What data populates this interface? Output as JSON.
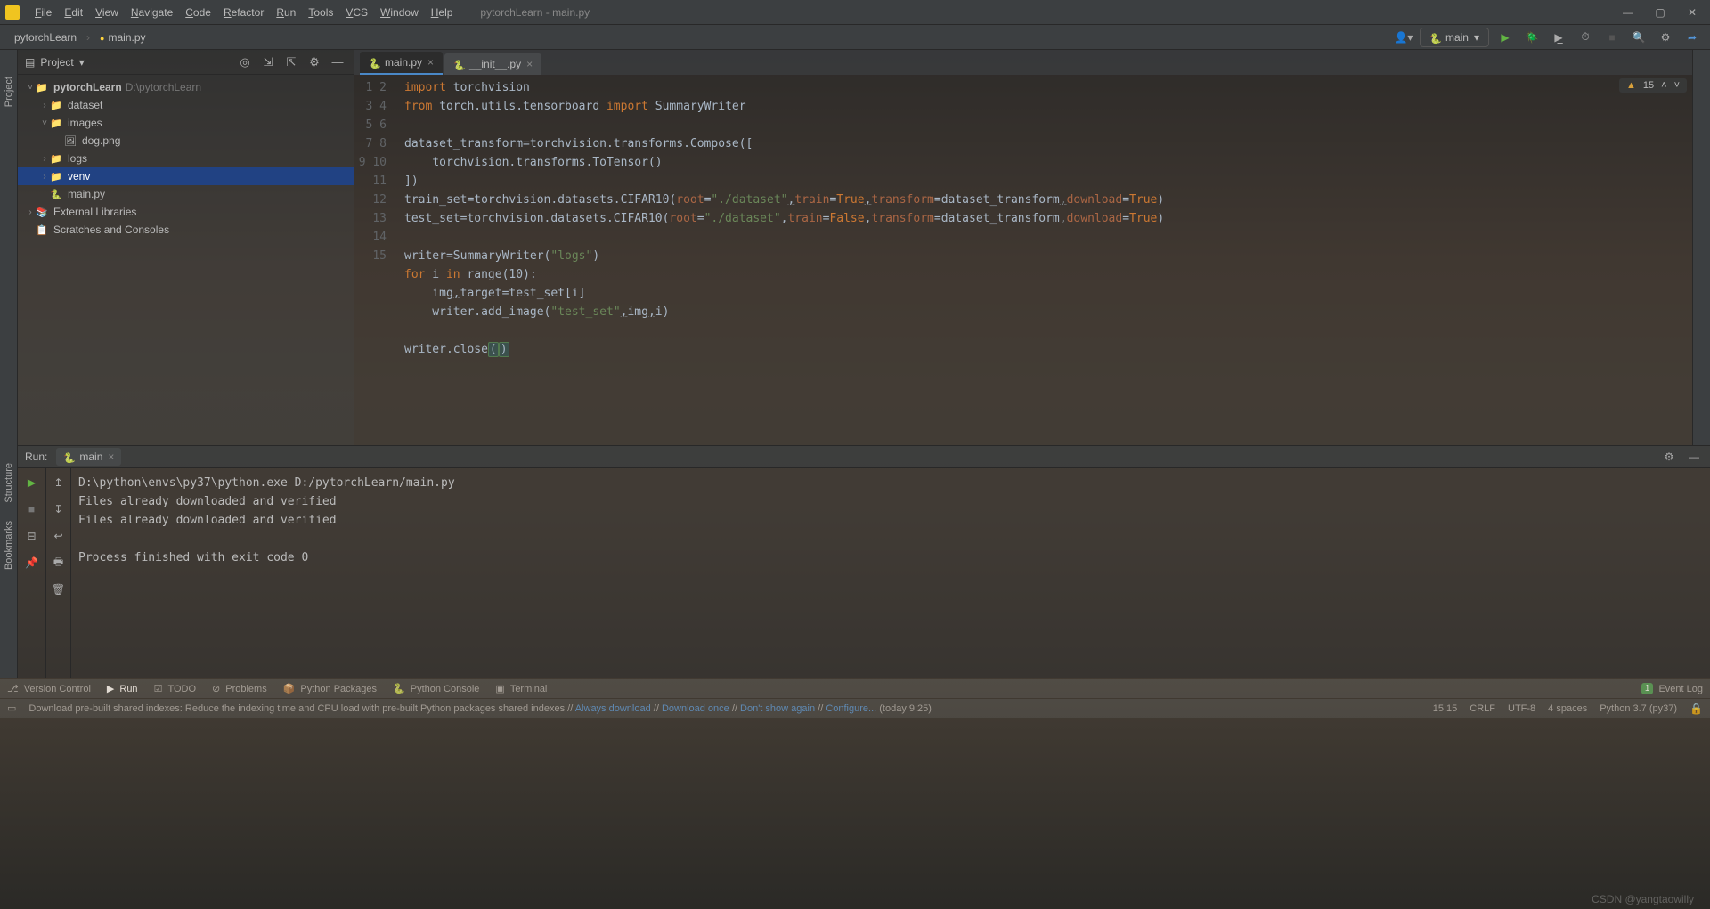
{
  "titlebar": {
    "menus": [
      "File",
      "Edit",
      "View",
      "Navigate",
      "Code",
      "Refactor",
      "Run",
      "Tools",
      "VCS",
      "Window",
      "Help"
    ],
    "title": "pytorchLearn - main.py"
  },
  "breadcrumb": {
    "root": "pytorchLearn",
    "file": "main.py"
  },
  "run_config": {
    "label": "main"
  },
  "project_panel": {
    "title": "Project",
    "root": {
      "name": "pytorchLearn",
      "path": "D:\\pytorchLearn"
    },
    "items": [
      {
        "name": "dataset",
        "type": "folder",
        "depth": 1,
        "expander": "›"
      },
      {
        "name": "images",
        "type": "folder",
        "depth": 1,
        "expander": "˅"
      },
      {
        "name": "dog.png",
        "type": "image",
        "depth": 2
      },
      {
        "name": "logs",
        "type": "folder",
        "depth": 1,
        "expander": "›"
      },
      {
        "name": "venv",
        "type": "venv",
        "depth": 1,
        "expander": "›",
        "selected": true
      },
      {
        "name": "main.py",
        "type": "python",
        "depth": 1
      }
    ],
    "external": "External Libraries",
    "scratches": "Scratches and Consoles"
  },
  "editor": {
    "tabs": [
      {
        "name": "main.py",
        "active": true
      },
      {
        "name": "__init__.py",
        "active": false
      }
    ],
    "warnings": "15",
    "lines": [
      {
        "n": 1,
        "segs": [
          {
            "t": "import",
            "c": "kw"
          },
          {
            "t": " torchvision"
          }
        ]
      },
      {
        "n": 2,
        "segs": [
          {
            "t": "from",
            "c": "kw"
          },
          {
            "t": " torch.utils.tensorboard "
          },
          {
            "t": "import",
            "c": "kw"
          },
          {
            "t": " SummaryWriter"
          }
        ]
      },
      {
        "n": 3,
        "segs": [
          {
            "t": ""
          }
        ]
      },
      {
        "n": 4,
        "segs": [
          {
            "t": "dataset_transform=torchvision.transforms.Compose(["
          }
        ]
      },
      {
        "n": 5,
        "segs": [
          {
            "t": "    torchvision.transforms.ToTensor()"
          }
        ]
      },
      {
        "n": 6,
        "segs": [
          {
            "t": "])"
          }
        ]
      },
      {
        "n": 7,
        "segs": [
          {
            "t": "train_set=torchvision.datasets.CIFAR10("
          },
          {
            "t": "root",
            "c": "arg"
          },
          {
            "t": "="
          },
          {
            "t": "\"./dataset\"",
            "c": "str"
          },
          {
            "t": ",",
            "c": "comma-u"
          },
          {
            "t": "train",
            "c": "arg"
          },
          {
            "t": "="
          },
          {
            "t": "True",
            "c": "bool"
          },
          {
            "t": ",",
            "c": "comma-u"
          },
          {
            "t": "transform",
            "c": "arg"
          },
          {
            "t": "=dataset_transform"
          },
          {
            "t": ",",
            "c": "comma-u"
          },
          {
            "t": "download",
            "c": "arg"
          },
          {
            "t": "="
          },
          {
            "t": "True",
            "c": "bool"
          },
          {
            "t": ")"
          }
        ]
      },
      {
        "n": 8,
        "segs": [
          {
            "t": "test_set=torchvision.datasets.CIFAR10("
          },
          {
            "t": "root",
            "c": "arg"
          },
          {
            "t": "="
          },
          {
            "t": "\"./dataset\"",
            "c": "str"
          },
          {
            "t": ",",
            "c": "comma-u"
          },
          {
            "t": "train",
            "c": "arg"
          },
          {
            "t": "="
          },
          {
            "t": "False",
            "c": "bool"
          },
          {
            "t": ",",
            "c": "comma-u"
          },
          {
            "t": "transform",
            "c": "arg"
          },
          {
            "t": "=dataset_transform"
          },
          {
            "t": ",",
            "c": "comma-u"
          },
          {
            "t": "download",
            "c": "arg"
          },
          {
            "t": "="
          },
          {
            "t": "True",
            "c": "bool"
          },
          {
            "t": ")"
          }
        ]
      },
      {
        "n": 9,
        "segs": [
          {
            "t": ""
          }
        ]
      },
      {
        "n": 10,
        "segs": [
          {
            "t": "writer=SummaryWriter("
          },
          {
            "t": "\"logs\"",
            "c": "str"
          },
          {
            "t": ")"
          }
        ]
      },
      {
        "n": 11,
        "segs": [
          {
            "t": "for",
            "c": "kw"
          },
          {
            "t": " i "
          },
          {
            "t": "in",
            "c": "kw"
          },
          {
            "t": " range(10):"
          }
        ]
      },
      {
        "n": 12,
        "segs": [
          {
            "t": "    img"
          },
          {
            "t": ",",
            "c": "comma-u"
          },
          {
            "t": "target=test_set[i]"
          }
        ]
      },
      {
        "n": 13,
        "segs": [
          {
            "t": "    writer.add_image("
          },
          {
            "t": "\"test_set\"",
            "c": "str"
          },
          {
            "t": ",",
            "c": "comma-u"
          },
          {
            "t": "img"
          },
          {
            "t": ",",
            "c": "comma-u"
          },
          {
            "t": "i)"
          }
        ]
      },
      {
        "n": 14,
        "segs": [
          {
            "t": ""
          }
        ]
      },
      {
        "n": 15,
        "segs": [
          {
            "t": "writer.close"
          },
          {
            "t": "(",
            "c": "paren-hl"
          },
          {
            "t": ")",
            "c": "paren-hl"
          }
        ]
      }
    ]
  },
  "run_panel": {
    "label": "Run:",
    "tab": "main",
    "lines": [
      "D:\\python\\envs\\py37\\python.exe D:/pytorchLearn/main.py",
      "Files already downloaded and verified",
      "Files already downloaded and verified",
      "",
      "Process finished with exit code 0"
    ]
  },
  "left_tools": {
    "project": "Project",
    "structure": "Structure",
    "bookmarks": "Bookmarks"
  },
  "bottom_tools": {
    "items": [
      {
        "name": "Version Control",
        "icon": "⎇"
      },
      {
        "name": "Run",
        "icon": "▶",
        "active": true
      },
      {
        "name": "TODO",
        "icon": "☑"
      },
      {
        "name": "Problems",
        "icon": "⊘"
      },
      {
        "name": "Python Packages",
        "icon": "📦"
      },
      {
        "name": "Python Console",
        "icon": "🐍"
      },
      {
        "name": "Terminal",
        "icon": "▣"
      }
    ],
    "event_log": "Event Log",
    "event_badge": "1"
  },
  "statusbar": {
    "message_prefix": "Download pre-built shared indexes: Reduce the indexing time and CPU load with pre-built Python packages shared indexes //",
    "links": [
      "Always download",
      "Download once",
      "Don't show again",
      "Configure..."
    ],
    "message_suffix": "(today 9:25)",
    "pos": "15:15",
    "eol": "CRLF",
    "enc": "UTF-8",
    "indent": "4 spaces",
    "interp": "Python 3.7 (py37)"
  },
  "watermark": "CSDN @yangtaowilly"
}
